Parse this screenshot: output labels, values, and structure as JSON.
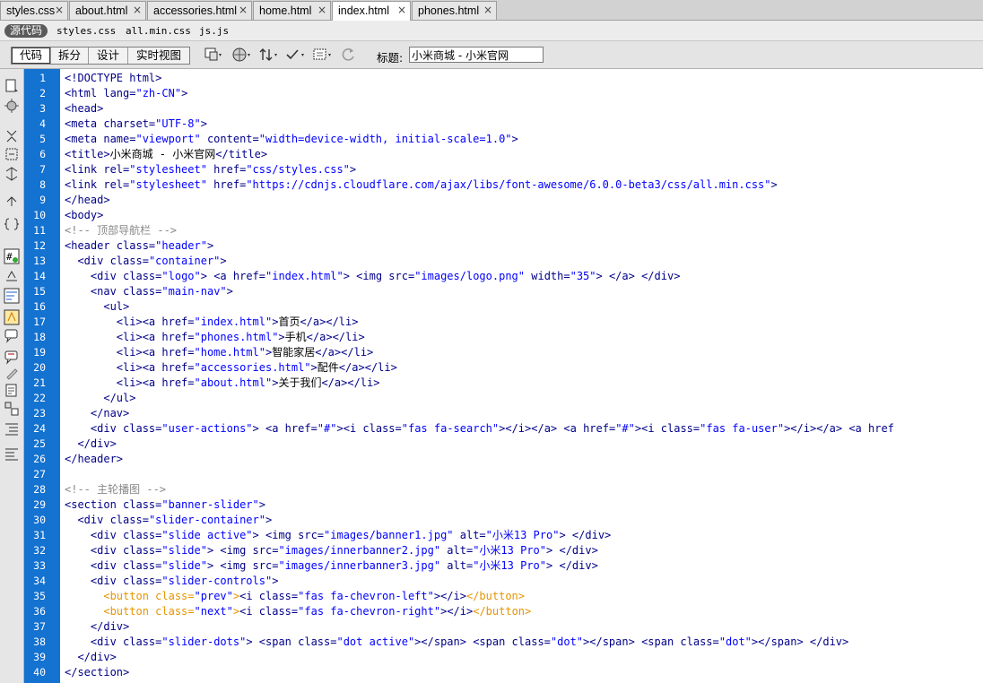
{
  "tabs": [
    {
      "label": "styles.css",
      "active": false
    },
    {
      "label": "about.html",
      "active": false
    },
    {
      "label": "accessories.html",
      "active": false
    },
    {
      "label": "home.html",
      "active": false
    },
    {
      "label": "index.html",
      "active": true
    },
    {
      "label": "phones.html",
      "active": false
    }
  ],
  "close_glyph": "×",
  "related": {
    "source_label": "源代码",
    "files": [
      "styles.css",
      "all.min.css",
      "js.js"
    ]
  },
  "toolbar": {
    "views": [
      {
        "label": "代码",
        "active": true
      },
      {
        "label": "拆分",
        "active": false
      },
      {
        "label": "设计",
        "active": false
      },
      {
        "label": "实时视图",
        "active": false
      }
    ],
    "icons": [
      "multiscreen-icon",
      "preview-browser-icon",
      "file-management-icon",
      "validate-icon",
      "visual-aids-icon",
      "refresh-icon"
    ],
    "title_label": "标题:",
    "title_value": "小米商城 - 小米官网"
  },
  "left_tools": [
    "open-documents-icon",
    "collapse-tag-icon",
    "collapse-selection-icon",
    "expand-all-icon",
    "select-parent-icon",
    "balance-braces-icon",
    "line-numbers-icon",
    "highlight-invalid-icon",
    "word-wrap-icon",
    "syntax-error-icon",
    "apply-comment-icon",
    "remove-comment-icon",
    "wrap-tag-icon",
    "recent-snippets-icon",
    "move-css-icon",
    "indent-icon",
    "outdent-icon",
    "format-source-icon"
  ],
  "colors": {
    "tag": "#000088",
    "attr_value": "#0000ff",
    "comment": "#888888",
    "orange_tag": "#e69500",
    "gutter": "#1472d0"
  },
  "code_lines": [
    [
      [
        "tag",
        "<!DOCTYPE html>"
      ]
    ],
    [
      [
        "tag",
        "<html lang="
      ],
      [
        "av",
        "\"zh-CN\""
      ],
      [
        "tag",
        ">"
      ]
    ],
    [
      [
        "tag",
        "<head>"
      ]
    ],
    [
      [
        "tag",
        "<meta charset="
      ],
      [
        "av",
        "\"UTF-8\""
      ],
      [
        "tag",
        ">"
      ]
    ],
    [
      [
        "tag",
        "<meta name="
      ],
      [
        "av",
        "\"viewport\""
      ],
      [
        "tag",
        " content="
      ],
      [
        "av",
        "\"width=device-width, initial-scale=1.0\""
      ],
      [
        "tag",
        ">"
      ]
    ],
    [
      [
        "tag",
        "<title>"
      ],
      [
        "pl",
        "小米商城 - 小米官网"
      ],
      [
        "tag",
        "</title>"
      ]
    ],
    [
      [
        "tag",
        "<link rel="
      ],
      [
        "av",
        "\"stylesheet\""
      ],
      [
        "tag",
        " href="
      ],
      [
        "av",
        "\"css/styles.css\""
      ],
      [
        "tag",
        ">"
      ]
    ],
    [
      [
        "tag",
        "<link rel="
      ],
      [
        "av",
        "\"stylesheet\""
      ],
      [
        "tag",
        " href="
      ],
      [
        "av",
        "\"https://cdnjs.cloudflare.com/ajax/libs/font-awesome/6.0.0-beta3/css/all.min.css\""
      ],
      [
        "tag",
        ">"
      ]
    ],
    [
      [
        "tag",
        "</head>"
      ]
    ],
    [
      [
        "tag",
        "<body>"
      ]
    ],
    [
      [
        "cm",
        "<!-- 顶部导航栏 -->"
      ]
    ],
    [
      [
        "tag",
        "<header class="
      ],
      [
        "av",
        "\"header\""
      ],
      [
        "tag",
        ">"
      ]
    ],
    [
      [
        "pl",
        "  "
      ],
      [
        "tag",
        "<div class="
      ],
      [
        "av",
        "\"container\""
      ],
      [
        "tag",
        ">"
      ]
    ],
    [
      [
        "pl",
        "    "
      ],
      [
        "tag",
        "<div class="
      ],
      [
        "av",
        "\"logo\""
      ],
      [
        "tag",
        "> "
      ],
      [
        "an",
        "<a href="
      ],
      [
        "av",
        "\"index.html\""
      ],
      [
        "tag",
        "> "
      ],
      [
        "an",
        "<img src="
      ],
      [
        "av",
        "\"images/logo.png\""
      ],
      [
        "an",
        " width="
      ],
      [
        "av",
        "\"35\""
      ],
      [
        "tag",
        "> "
      ],
      [
        "an",
        "</a>"
      ],
      [
        "tag",
        " </div>"
      ]
    ],
    [
      [
        "pl",
        "    "
      ],
      [
        "tag",
        "<nav class="
      ],
      [
        "av",
        "\"main-nav\""
      ],
      [
        "tag",
        ">"
      ]
    ],
    [
      [
        "pl",
        "      "
      ],
      [
        "tag",
        "<ul>"
      ]
    ],
    [
      [
        "pl",
        "        "
      ],
      [
        "tag",
        "<li>"
      ],
      [
        "an",
        "<a href="
      ],
      [
        "av",
        "\"index.html\""
      ],
      [
        "an",
        ">"
      ],
      [
        "pl",
        "首页"
      ],
      [
        "an",
        "</a>"
      ],
      [
        "tag",
        "</li>"
      ]
    ],
    [
      [
        "pl",
        "        "
      ],
      [
        "tag",
        "<li>"
      ],
      [
        "an",
        "<a href="
      ],
      [
        "av",
        "\"phones.html\""
      ],
      [
        "an",
        ">"
      ],
      [
        "pl",
        "手机"
      ],
      [
        "an",
        "</a>"
      ],
      [
        "tag",
        "</li>"
      ]
    ],
    [
      [
        "pl",
        "        "
      ],
      [
        "tag",
        "<li>"
      ],
      [
        "an",
        "<a href="
      ],
      [
        "av",
        "\"home.html\""
      ],
      [
        "an",
        ">"
      ],
      [
        "pl",
        "智能家居"
      ],
      [
        "an",
        "</a>"
      ],
      [
        "tag",
        "</li>"
      ]
    ],
    [
      [
        "pl",
        "        "
      ],
      [
        "tag",
        "<li>"
      ],
      [
        "an",
        "<a href="
      ],
      [
        "av",
        "\"accessories.html\""
      ],
      [
        "an",
        ">"
      ],
      [
        "pl",
        "配件"
      ],
      [
        "an",
        "</a>"
      ],
      [
        "tag",
        "</li>"
      ]
    ],
    [
      [
        "pl",
        "        "
      ],
      [
        "tag",
        "<li>"
      ],
      [
        "an",
        "<a href="
      ],
      [
        "av",
        "\"about.html\""
      ],
      [
        "an",
        ">"
      ],
      [
        "pl",
        "关于我们"
      ],
      [
        "an",
        "</a>"
      ],
      [
        "tag",
        "</li>"
      ]
    ],
    [
      [
        "pl",
        "      "
      ],
      [
        "tag",
        "</ul>"
      ]
    ],
    [
      [
        "pl",
        "    "
      ],
      [
        "tag",
        "</nav>"
      ]
    ],
    [
      [
        "pl",
        "    "
      ],
      [
        "tag",
        "<div class="
      ],
      [
        "av",
        "\"user-actions\""
      ],
      [
        "tag",
        "> "
      ],
      [
        "an",
        "<a href="
      ],
      [
        "av",
        "\"#\""
      ],
      [
        "an",
        ">"
      ],
      [
        "tag",
        "<i class="
      ],
      [
        "av",
        "\"fas fa-search\""
      ],
      [
        "tag",
        "></i>"
      ],
      [
        "an",
        "</a>"
      ],
      [
        "pl",
        " "
      ],
      [
        "an",
        "<a href="
      ],
      [
        "av",
        "\"#\""
      ],
      [
        "an",
        ">"
      ],
      [
        "tag",
        "<i class="
      ],
      [
        "av",
        "\"fas fa-user\""
      ],
      [
        "tag",
        "></i>"
      ],
      [
        "an",
        "</a>"
      ],
      [
        "pl",
        " "
      ],
      [
        "an",
        "<a href"
      ]
    ],
    [
      [
        "pl",
        "  "
      ],
      [
        "tag",
        "</div>"
      ]
    ],
    [
      [
        "tag",
        "</header>"
      ]
    ],
    [
      [
        "pl",
        ""
      ]
    ],
    [
      [
        "cm",
        "<!-- 主轮播图 -->"
      ]
    ],
    [
      [
        "tag",
        "<section class="
      ],
      [
        "av",
        "\"banner-slider\""
      ],
      [
        "tag",
        ">"
      ]
    ],
    [
      [
        "pl",
        "  "
      ],
      [
        "tag",
        "<div class="
      ],
      [
        "av",
        "\"slider-container\""
      ],
      [
        "tag",
        ">"
      ]
    ],
    [
      [
        "pl",
        "    "
      ],
      [
        "tag",
        "<div class="
      ],
      [
        "av",
        "\"slide active\""
      ],
      [
        "tag",
        "> "
      ],
      [
        "an",
        "<img src="
      ],
      [
        "av",
        "\"images/banner1.jpg\""
      ],
      [
        "an",
        " alt="
      ],
      [
        "av",
        "\"小米13 Pro\""
      ],
      [
        "an",
        ">"
      ],
      [
        "tag",
        " </div>"
      ]
    ],
    [
      [
        "pl",
        "    "
      ],
      [
        "tag",
        "<div class="
      ],
      [
        "av",
        "\"slide\""
      ],
      [
        "tag",
        "> "
      ],
      [
        "an",
        "<img src="
      ],
      [
        "av",
        "\"images/innerbanner2.jpg\""
      ],
      [
        "an",
        " alt="
      ],
      [
        "av",
        "\"小米13 Pro\""
      ],
      [
        "an",
        ">"
      ],
      [
        "tag",
        " </div>"
      ]
    ],
    [
      [
        "pl",
        "    "
      ],
      [
        "tag",
        "<div class="
      ],
      [
        "av",
        "\"slide\""
      ],
      [
        "tag",
        "> "
      ],
      [
        "an",
        "<img src="
      ],
      [
        "av",
        "\"images/innerbanner3.jpg\""
      ],
      [
        "an",
        " alt="
      ],
      [
        "av",
        "\"小米13 Pro\""
      ],
      [
        "an",
        ">"
      ],
      [
        "tag",
        " </div>"
      ]
    ],
    [
      [
        "pl",
        "    "
      ],
      [
        "tag",
        "<div class="
      ],
      [
        "av",
        "\"slider-controls\""
      ],
      [
        "tag",
        ">"
      ]
    ],
    [
      [
        "pl",
        "      "
      ],
      [
        "ot",
        "<button class="
      ],
      [
        "ov",
        "\"prev\""
      ],
      [
        "ot",
        ">"
      ],
      [
        "tag",
        "<i class="
      ],
      [
        "av",
        "\"fas fa-chevron-left\""
      ],
      [
        "tag",
        "></i>"
      ],
      [
        "ot",
        "</button>"
      ]
    ],
    [
      [
        "pl",
        "      "
      ],
      [
        "ot",
        "<button class="
      ],
      [
        "ov",
        "\"next\""
      ],
      [
        "ot",
        ">"
      ],
      [
        "tag",
        "<i class="
      ],
      [
        "av",
        "\"fas fa-chevron-right\""
      ],
      [
        "tag",
        "></i>"
      ],
      [
        "ot",
        "</button>"
      ]
    ],
    [
      [
        "pl",
        "    "
      ],
      [
        "tag",
        "</div>"
      ]
    ],
    [
      [
        "pl",
        "    "
      ],
      [
        "tag",
        "<div class="
      ],
      [
        "av",
        "\"slider-dots\""
      ],
      [
        "tag",
        "> "
      ],
      [
        "tag",
        "<span class="
      ],
      [
        "av",
        "\"dot active\""
      ],
      [
        "tag",
        "></span> "
      ],
      [
        "tag",
        "<span class="
      ],
      [
        "av",
        "\"dot\""
      ],
      [
        "tag",
        "></span> "
      ],
      [
        "tag",
        "<span class="
      ],
      [
        "av",
        "\"dot\""
      ],
      [
        "tag",
        "></span> </div>"
      ]
    ],
    [
      [
        "pl",
        "  "
      ],
      [
        "tag",
        "</div>"
      ]
    ],
    [
      [
        "tag",
        "</section>"
      ]
    ]
  ]
}
